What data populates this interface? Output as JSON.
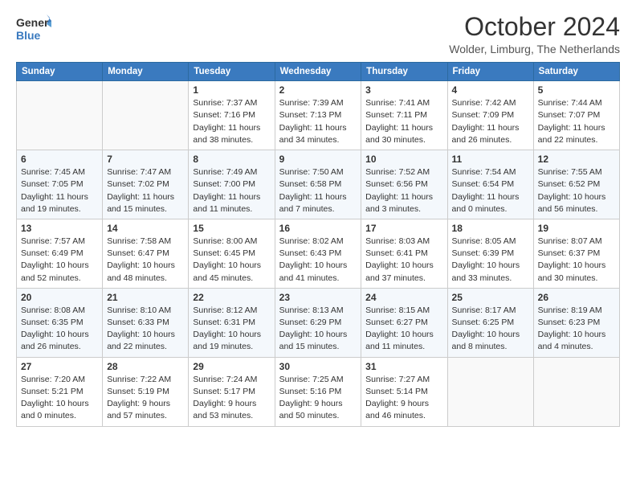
{
  "logo": {
    "line1": "General",
    "line2": "Blue"
  },
  "title": "October 2024",
  "subtitle": "Wolder, Limburg, The Netherlands",
  "days_of_week": [
    "Sunday",
    "Monday",
    "Tuesday",
    "Wednesday",
    "Thursday",
    "Friday",
    "Saturday"
  ],
  "weeks": [
    [
      {
        "day": "",
        "info": ""
      },
      {
        "day": "",
        "info": ""
      },
      {
        "day": "1",
        "sunrise": "7:37 AM",
        "sunset": "7:16 PM",
        "daylight": "11 hours and 38 minutes."
      },
      {
        "day": "2",
        "sunrise": "7:39 AM",
        "sunset": "7:13 PM",
        "daylight": "11 hours and 34 minutes."
      },
      {
        "day": "3",
        "sunrise": "7:41 AM",
        "sunset": "7:11 PM",
        "daylight": "11 hours and 30 minutes."
      },
      {
        "day": "4",
        "sunrise": "7:42 AM",
        "sunset": "7:09 PM",
        "daylight": "11 hours and 26 minutes."
      },
      {
        "day": "5",
        "sunrise": "7:44 AM",
        "sunset": "7:07 PM",
        "daylight": "11 hours and 22 minutes."
      }
    ],
    [
      {
        "day": "6",
        "sunrise": "7:45 AM",
        "sunset": "7:05 PM",
        "daylight": "11 hours and 19 minutes."
      },
      {
        "day": "7",
        "sunrise": "7:47 AM",
        "sunset": "7:02 PM",
        "daylight": "11 hours and 15 minutes."
      },
      {
        "day": "8",
        "sunrise": "7:49 AM",
        "sunset": "7:00 PM",
        "daylight": "11 hours and 11 minutes."
      },
      {
        "day": "9",
        "sunrise": "7:50 AM",
        "sunset": "6:58 PM",
        "daylight": "11 hours and 7 minutes."
      },
      {
        "day": "10",
        "sunrise": "7:52 AM",
        "sunset": "6:56 PM",
        "daylight": "11 hours and 3 minutes."
      },
      {
        "day": "11",
        "sunrise": "7:54 AM",
        "sunset": "6:54 PM",
        "daylight": "11 hours and 0 minutes."
      },
      {
        "day": "12",
        "sunrise": "7:55 AM",
        "sunset": "6:52 PM",
        "daylight": "10 hours and 56 minutes."
      }
    ],
    [
      {
        "day": "13",
        "sunrise": "7:57 AM",
        "sunset": "6:49 PM",
        "daylight": "10 hours and 52 minutes."
      },
      {
        "day": "14",
        "sunrise": "7:58 AM",
        "sunset": "6:47 PM",
        "daylight": "10 hours and 48 minutes."
      },
      {
        "day": "15",
        "sunrise": "8:00 AM",
        "sunset": "6:45 PM",
        "daylight": "10 hours and 45 minutes."
      },
      {
        "day": "16",
        "sunrise": "8:02 AM",
        "sunset": "6:43 PM",
        "daylight": "10 hours and 41 minutes."
      },
      {
        "day": "17",
        "sunrise": "8:03 AM",
        "sunset": "6:41 PM",
        "daylight": "10 hours and 37 minutes."
      },
      {
        "day": "18",
        "sunrise": "8:05 AM",
        "sunset": "6:39 PM",
        "daylight": "10 hours and 33 minutes."
      },
      {
        "day": "19",
        "sunrise": "8:07 AM",
        "sunset": "6:37 PM",
        "daylight": "10 hours and 30 minutes."
      }
    ],
    [
      {
        "day": "20",
        "sunrise": "8:08 AM",
        "sunset": "6:35 PM",
        "daylight": "10 hours and 26 minutes."
      },
      {
        "day": "21",
        "sunrise": "8:10 AM",
        "sunset": "6:33 PM",
        "daylight": "10 hours and 22 minutes."
      },
      {
        "day": "22",
        "sunrise": "8:12 AM",
        "sunset": "6:31 PM",
        "daylight": "10 hours and 19 minutes."
      },
      {
        "day": "23",
        "sunrise": "8:13 AM",
        "sunset": "6:29 PM",
        "daylight": "10 hours and 15 minutes."
      },
      {
        "day": "24",
        "sunrise": "8:15 AM",
        "sunset": "6:27 PM",
        "daylight": "10 hours and 11 minutes."
      },
      {
        "day": "25",
        "sunrise": "8:17 AM",
        "sunset": "6:25 PM",
        "daylight": "10 hours and 8 minutes."
      },
      {
        "day": "26",
        "sunrise": "8:19 AM",
        "sunset": "6:23 PM",
        "daylight": "10 hours and 4 minutes."
      }
    ],
    [
      {
        "day": "27",
        "sunrise": "7:20 AM",
        "sunset": "5:21 PM",
        "daylight": "10 hours and 0 minutes."
      },
      {
        "day": "28",
        "sunrise": "7:22 AM",
        "sunset": "5:19 PM",
        "daylight": "9 hours and 57 minutes."
      },
      {
        "day": "29",
        "sunrise": "7:24 AM",
        "sunset": "5:17 PM",
        "daylight": "9 hours and 53 minutes."
      },
      {
        "day": "30",
        "sunrise": "7:25 AM",
        "sunset": "5:16 PM",
        "daylight": "9 hours and 50 minutes."
      },
      {
        "day": "31",
        "sunrise": "7:27 AM",
        "sunset": "5:14 PM",
        "daylight": "9 hours and 46 minutes."
      },
      {
        "day": "",
        "info": ""
      },
      {
        "day": "",
        "info": ""
      }
    ]
  ]
}
